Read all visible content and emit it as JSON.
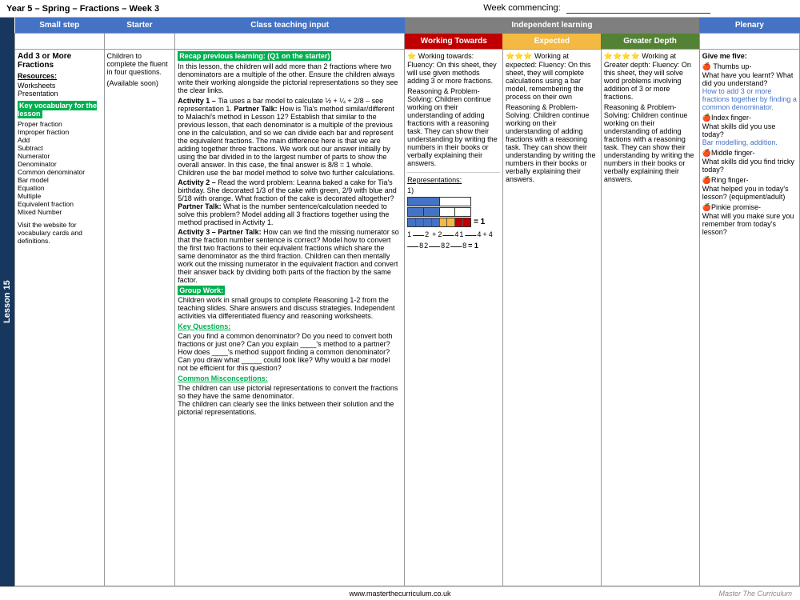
{
  "header": {
    "title": "Year 5 – Spring – Fractions – Week 3",
    "week_commencing_label": "Week commencing:",
    "lesson_label": "Lesson 15"
  },
  "column_headers": {
    "small_step": "Small step",
    "starter": "Starter",
    "teaching": "Class teaching input",
    "independent": "Independent learning",
    "working_towards": "Working Towards",
    "expected": "Expected",
    "greater_depth": "Greater Depth",
    "plenary": "Plenary"
  },
  "small_step": {
    "title": "Add 3 or More Fractions",
    "resources_label": "Resources:",
    "resources": [
      "Worksheets",
      "Presentation"
    ],
    "key_vocab_label": "Key vocabulary for the lesson",
    "vocab_list": [
      "Proper fraction",
      "Improper fraction",
      "Add",
      "Subtract",
      "Numerator",
      "Denominator",
      "Common denominator",
      "Bar model",
      "Equation",
      "Multiple",
      "Equivalent fraction",
      "Mixed Number"
    ],
    "visit_text": "Visit the website for vocabulary cards and definitions."
  },
  "starter": {
    "text": "Children to complete the fluent in four questions.",
    "available": "(Available soon)"
  },
  "teaching": {
    "recap_label": "Recap previous learning: (Q1 on the starter)",
    "recap_text": "In this lesson, the children will add more than 2 fractions where two denominators are a multiple of the other. Ensure the children always write their working alongside the pictorial representations so they see the clear links.",
    "activity1_label": "Activity 1 –",
    "activity1_text": "Tia uses a bar model to calculate ½ + ¼ + 2/8 – see representation 1. Partner Talk: How is Tia's method similar/different to Malachi's method in Lesson 12? Establish that similar to the previous lesson, that each denominator is a multiple of the previous one in the calculation, and so we can divide each bar and represent the equivalent fractions. The main difference here is that we are adding together three fractions. We work out our answer initially by using the bar divided in to the largest number of parts to show the overall answer. In this case, the final answer is 8/8 = 1 whole. Children use the bar model method to solve two further calculations.",
    "activity2_label": "Activity 2 –",
    "activity2_text": "Read the word problem: Leanna baked a cake for Tia's birthday. She decorated 1/3 of the cake with green, 2/9 with blue and 5/18 with orange. What fraction of the cake is decorated altogether? Partner Talk: What is the number sentence/calculation needed to solve this problem? Model adding all 3 fractions together using the method practised in Activity 1.",
    "activity3_label": "Activity 3 –",
    "activity3_text": "Partner Talk: How can we find the missing numerator so that the fraction number sentence is correct? Model how to convert the first two fractions to their equivalent fractions which share the same denominator as the third fraction. Children can then mentally work out the missing numerator in the equivalent fraction and convert their answer back by dividing both parts of the fraction by the same factor.",
    "group_work_label": "Group Work:",
    "group_work_text": "Children work in small groups to complete Reasoning 1-2 from the teaching slides. Share answers and discuss strategies. Independent activities via differentiated fluency and reasoning worksheets.",
    "key_questions_label": "Key Questions:",
    "key_questions_text": "Can you find a common denominator? Do you need to convert both fractions or just one? Can you explain ____'s method to a partner? How does ____'s method support finding a common denominator? Can you draw what _____ could look like? Why would a bar model not be efficient for this question?",
    "misconceptions_label": "Common Misconceptions:",
    "misconceptions_text": "The children can use pictorial representations to convert the fractions so they have the same denominator.\nThe children can clearly see the links between their solution and the pictorial representations."
  },
  "working_towards": {
    "header": "Working Towards",
    "text1": "Working towards: Fluency: On this sheet, they will use given methods adding 3 or more fractions.",
    "text2": "Reasoning & Problem-Solving: Children continue working on their understanding of adding fractions with a reasoning task. They can show their understanding by writing the numbers in their books or verbally explaining their answers."
  },
  "expected": {
    "header": "Expected",
    "stars": "★★★",
    "text1": "Working at expected: Fluency: On this sheet, they will complete calculations using a bar model, remembering the process on their own",
    "text2": "Reasoning & Problem-Solving: Children continue working on their understanding of adding fractions with a reasoning task. They can show their understanding by writing the numbers in their books or verbally explaining their answers."
  },
  "greater_depth": {
    "header": "Greater Depth",
    "stars": "★★★★",
    "text1": "Working at Greater depth: Fluency: On this sheet, they will solve word problems involving addition of 3 or more fractions.",
    "text2": "Reasoning & Problem-Solving: Children continue working on their understanding of adding fractions with a reasoning task. They can show their understanding by writing the numbers in their books or verbally explaining their answers."
  },
  "representations": {
    "label": "Representations:",
    "item1": "1)"
  },
  "plenary": {
    "intro": "Give me five:",
    "thumbs_label": "🍎 Thumbs up-",
    "thumbs_text": "What have you learnt? What did you understand?",
    "thumbs_highlight": "How to add 3 or more fractions together by finding a common denominator.",
    "index_label": "🍎Index finger-",
    "index_text": "What skills did you use today?",
    "index_highlight": "Bar modelling, addition.",
    "middle_label": "🍎Middle finger-",
    "middle_text": "What skills did you find tricky today?",
    "ring_label": "🍎Ring finger-",
    "ring_text": "What helped you in today's lesson? (equipment/adult)",
    "pinkie_label": "🍎Pinkie promise-",
    "pinkie_text": "What will you make sure you remember from today's lesson?"
  },
  "footer": {
    "website": "www.masterthecurriculum.co.uk",
    "watermark": "Master The Curriculum"
  }
}
